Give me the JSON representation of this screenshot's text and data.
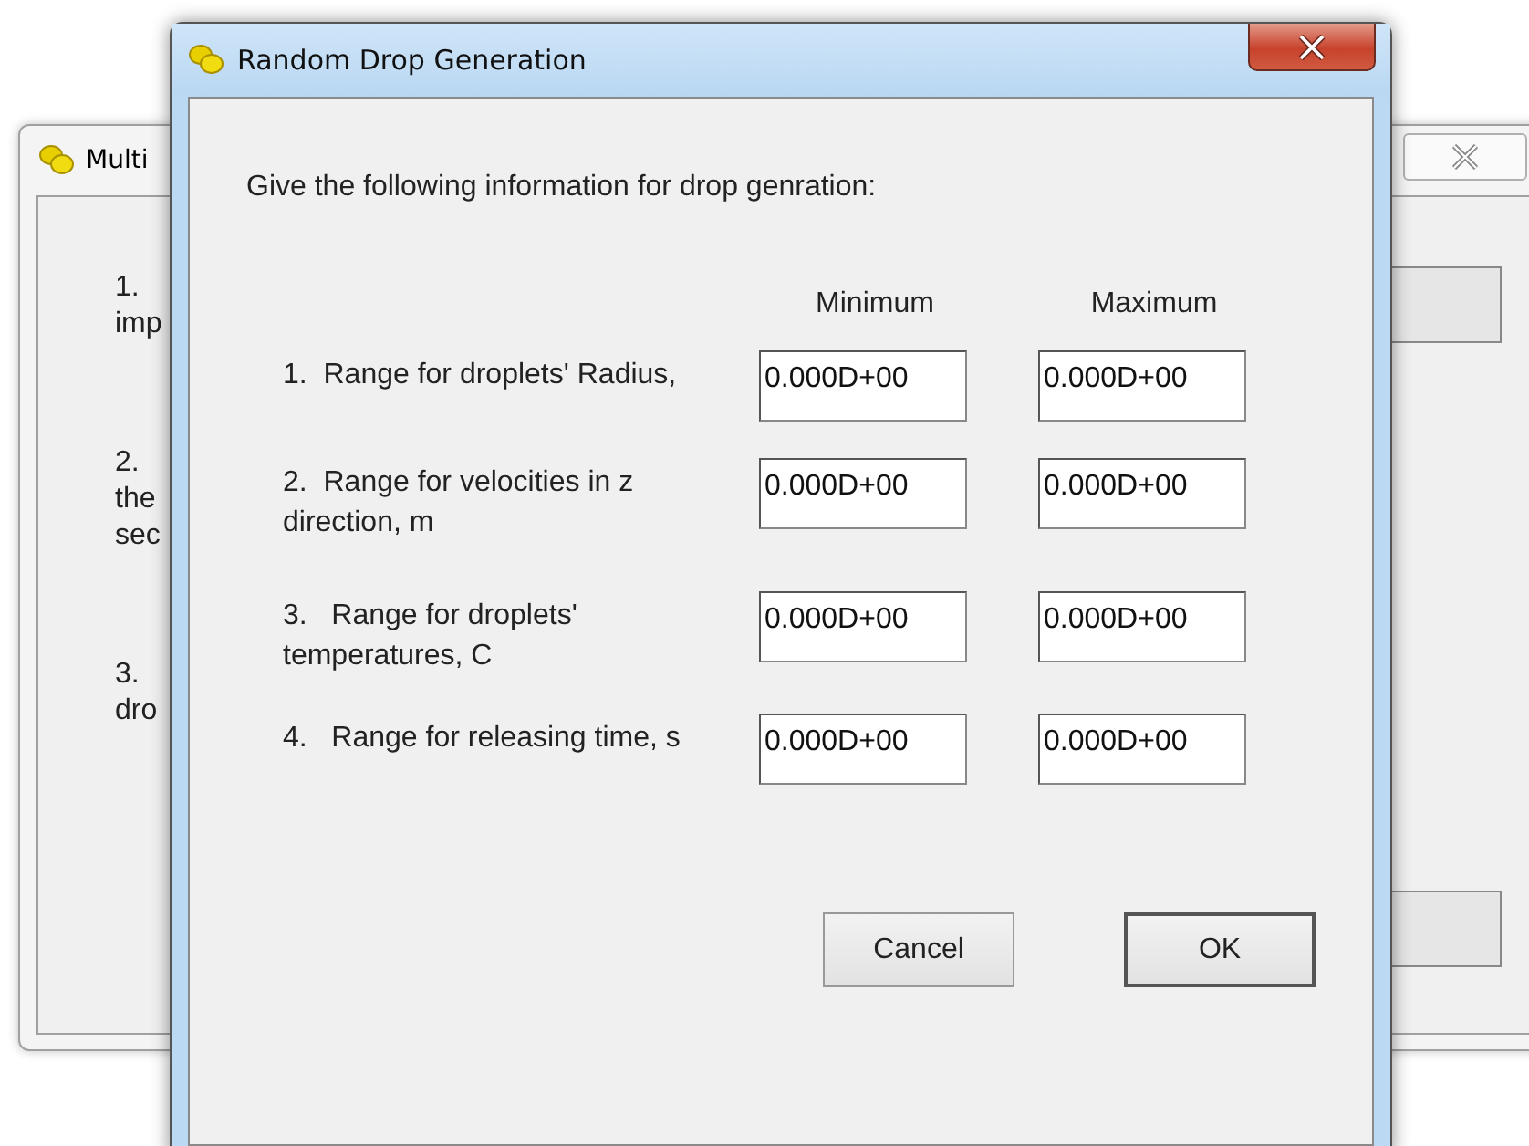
{
  "background_window": {
    "title": "Multi",
    "text_fragments": [
      {
        "lines": [
          "1.",
          "imp"
        ]
      },
      {
        "lines": [
          "2.",
          "the",
          "sec"
        ]
      },
      {
        "lines": [
          "3.",
          "dro"
        ]
      }
    ]
  },
  "dialog": {
    "title": "Random Drop Generation",
    "prompt": "Give the following information for drop genration:",
    "columns": [
      "Minimum",
      "Maximum"
    ],
    "rows": [
      {
        "label_lines": [
          "1.  Range for droplets' Radius,"
        ],
        "minimum": "0.000D+00",
        "maximum": "0.000D+00"
      },
      {
        "label_lines": [
          "2.  Range for velocities in z",
          "direction, m"
        ],
        "minimum": "0.000D+00",
        "maximum": "0.000D+00"
      },
      {
        "label_lines": [
          "3.   Range for droplets'",
          "temperatures, C"
        ],
        "minimum": "0.000D+00",
        "maximum": "0.000D+00"
      },
      {
        "label_lines": [
          "4.   Range for releasing time, s"
        ],
        "minimum": "0.000D+00",
        "maximum": "0.000D+00"
      }
    ],
    "buttons": [
      {
        "label": "Cancel",
        "default": false
      },
      {
        "label": "OK",
        "default": true
      }
    ]
  }
}
